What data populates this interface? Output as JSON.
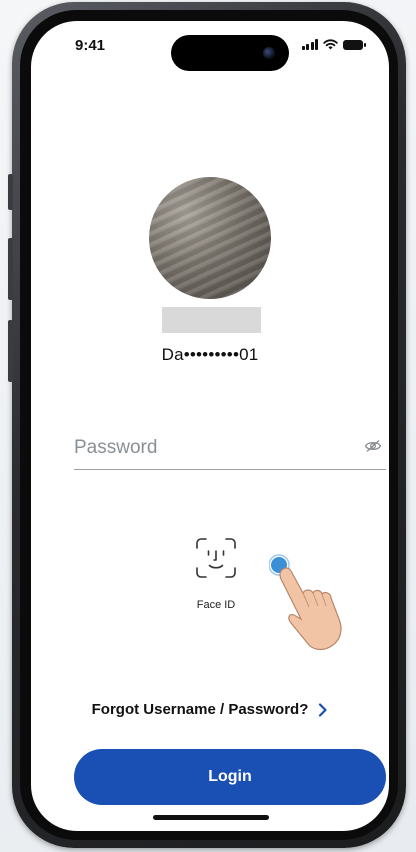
{
  "status_bar": {
    "time": "9:41"
  },
  "profile": {
    "account_masked": "Da•••••••••01"
  },
  "password": {
    "placeholder": "Password",
    "value": ""
  },
  "face_id": {
    "label": "Face ID",
    "icon": "face-id-icon"
  },
  "forgot": {
    "label": "Forgot Username / Password?"
  },
  "login": {
    "label": "Login"
  },
  "colors": {
    "primary": "#1a4fb4",
    "tap_dot": "#3a8fd6"
  }
}
